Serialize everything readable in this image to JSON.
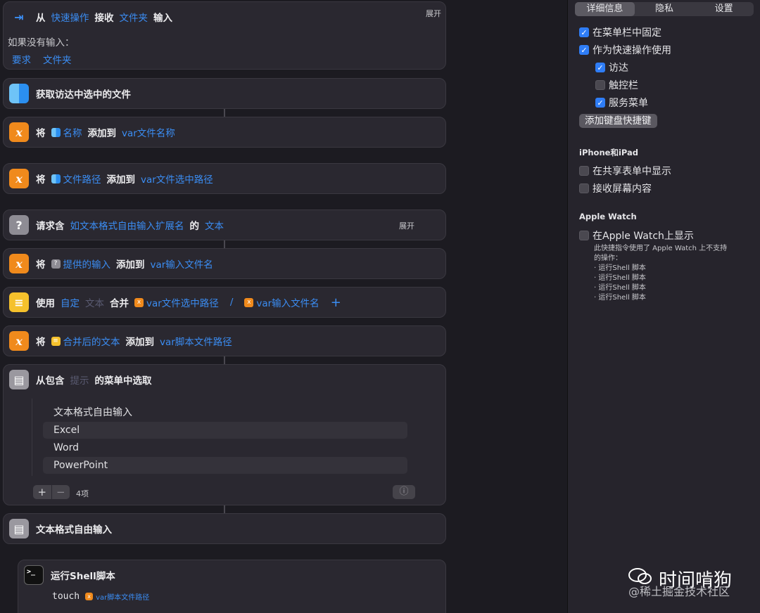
{
  "blocks": {
    "receive": {
      "w1": "从",
      "w2": "快速操作",
      "w3": "接收",
      "w4": "文件夹",
      "w5": "输入",
      "expand": "展开",
      "if_no_input": "如果没有输入：",
      "opt1": "要求",
      "opt2": "文件夹"
    },
    "finder": {
      "label": "获取访达中选中的文件"
    },
    "add1": {
      "w1": "将",
      "w2": "名称",
      "w3": "添加到",
      "w4": "var文件名称"
    },
    "add2": {
      "w1": "将",
      "w2": "文件路径",
      "w3": "添加到",
      "w4": "var文件选中路径"
    },
    "ask": {
      "w1": "请求含",
      "w2": "如文本格式自由输入扩展名",
      "w3": "的",
      "w4": "文本",
      "expand": "展开"
    },
    "add3": {
      "w1": "将",
      "w2": "提供的输入",
      "w3": "添加到",
      "w4": "var输入文件名"
    },
    "combine": {
      "w1": "使用",
      "w2": "自定",
      "w3": "文本",
      "w4": "合并",
      "w5": "var文件选中路径",
      "w6": "/",
      "w7": "var输入文件名",
      "plus": "+"
    },
    "add4": {
      "w1": "将",
      "w2": "合并后的文本",
      "w3": "添加到",
      "w4": "var脚本文件路径"
    },
    "menu": {
      "w1": "从包含",
      "w2": "提示",
      "w3": "的菜单中选取",
      "items": [
        "文本格式自由输入",
        "Excel",
        "Word",
        "PowerPoint"
      ],
      "plus": "+",
      "minus": "−",
      "count": "4项",
      "info": "ⓘ"
    },
    "freeinput": {
      "label": "文本格式自由输入"
    },
    "shell": {
      "label": "运行Shell脚本",
      "cmd": "touch",
      "var": "var脚本文件路径",
      "prompt": ">_"
    }
  },
  "panel": {
    "tabs": [
      "详细信息",
      "隐私",
      "设置"
    ],
    "pin_menubar": "在菜单栏中固定",
    "use_quick_action": "作为快速操作使用",
    "finder": "访达",
    "touchbar": "触控栏",
    "services_menu": "服务菜单",
    "add_shortcut": "添加键盘快捷键",
    "iphone_section": "iPhone和iPad",
    "show_share_sheet": "在共享表单中显示",
    "receive_screen": "接收屏幕内容",
    "watch_section": "Apple Watch",
    "show_watch": "在Apple Watch上显示",
    "watch_note": [
      "此快捷指令使用了 Apple Watch 上不支持",
      "的操作：",
      "· 运行Shell 脚本",
      "· 运行Shell 脚本",
      "· 运行Shell 脚本",
      "· 运行Shell 脚本"
    ]
  },
  "watermark": {
    "main": "时间啃狗",
    "sub": "@稀土掘金技术社区"
  }
}
